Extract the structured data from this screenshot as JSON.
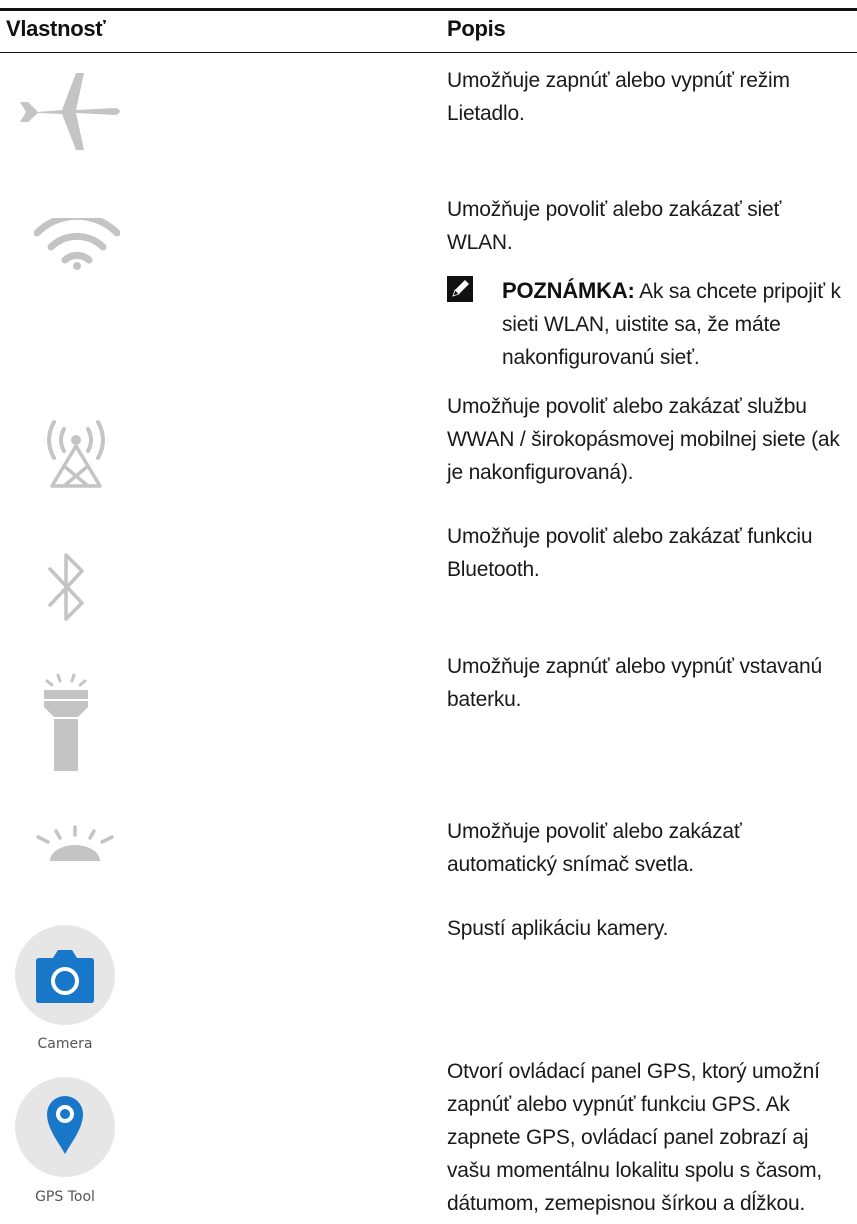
{
  "table": {
    "headers": {
      "property": "Vlastnosť",
      "description": "Popis"
    },
    "rows": [
      {
        "icon": "airplane-icon",
        "description": "Umožňuje zapnúť alebo vypnúť režim Lietadlo."
      },
      {
        "icon": "wifi-icon",
        "description": "Umožňuje povoliť alebo zakázať sieť WLAN.",
        "note": {
          "label": "POZNÁMKA:",
          "text": " Ak sa chcete pripojiť k sieti WLAN, uistite sa, že máte nakonfigurovanú sieť."
        }
      },
      {
        "icon": "cellular-antenna-icon",
        "description": "Umožňuje povoliť alebo zakázať službu WWAN / širokopásmovej mobilnej siete (ak je nakonfigurovaná)."
      },
      {
        "icon": "bluetooth-icon",
        "description": "Umožňuje povoliť alebo zakázať funkciu Bluetooth."
      },
      {
        "icon": "flashlight-icon",
        "description": "Umožňuje zapnúť alebo vypnúť vstavanú baterku."
      },
      {
        "icon": "brightness-sensor-icon",
        "description": "Umožňuje povoliť alebo zakázať automatický snímač svetla."
      },
      {
        "icon": "camera-icon",
        "icon_label": "Camera",
        "description": "Spustí aplikáciu kamery."
      },
      {
        "icon": "gps-pin-icon",
        "icon_label": "GPS Tool",
        "description": "Otvorí ovládací panel GPS, ktorý umožní zapnúť alebo vypnúť funkciu GPS. Ak zapnete GPS, ovládací panel zobrazí aj vašu momentálnu lokalitu spolu s časom, dátumom, zemepisnou šírkou a dĺžkou."
      }
    ]
  },
  "colors": {
    "icon_gray": "#c4c4c4",
    "app_blue": "#1877c9",
    "tile_gray": "#e6e6e6"
  }
}
